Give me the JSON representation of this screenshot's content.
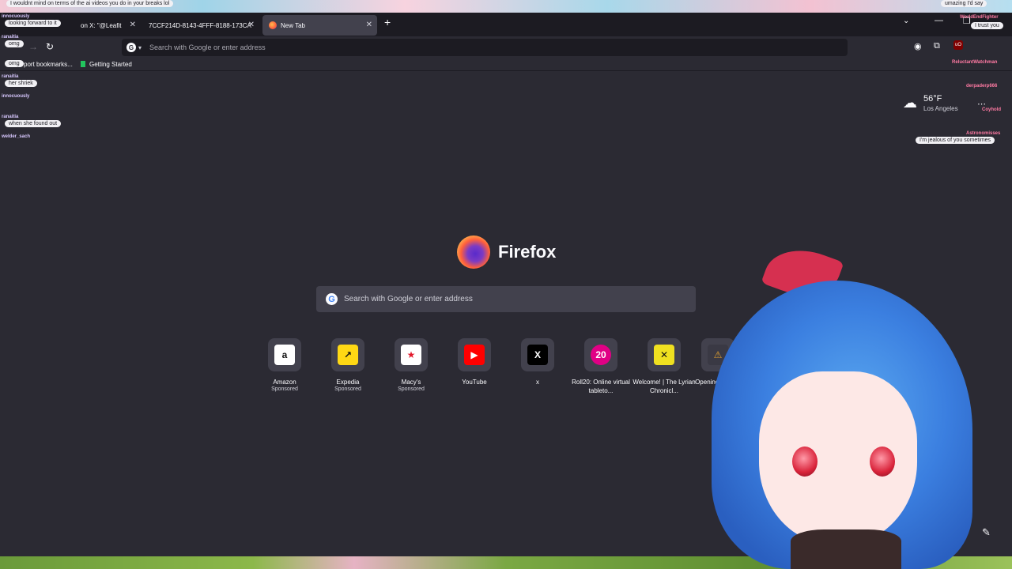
{
  "tabs": [
    {
      "label": "on X: \"@Leafit",
      "active": false
    },
    {
      "label": "7CCF214D-8143-4FFF-8188-173CA",
      "active": false
    },
    {
      "label": "New Tab",
      "active": true
    }
  ],
  "toolbar": {
    "url_placeholder": "Search with Google or enter address",
    "ublock_label": "uO"
  },
  "bookmarks": [
    {
      "label": "port bookmarks..."
    },
    {
      "label": "Getting Started"
    }
  ],
  "weather": {
    "temp": "56°F",
    "location": "Los Angeles"
  },
  "brand": {
    "wordmark": "Firefox"
  },
  "search": {
    "placeholder": "Search with Google or enter address"
  },
  "shortcuts": [
    {
      "title": "Amazon",
      "sub": "Sponsored",
      "icon_glyph": "a",
      "icon_bg": "#ffffff",
      "icon_fg": "#111111"
    },
    {
      "title": "Expedia",
      "sub": "Sponsored",
      "icon_glyph": "↗",
      "icon_bg": "#ffd814",
      "icon_fg": "#111111"
    },
    {
      "title": "Macy's",
      "sub": "Sponsored",
      "icon_glyph": "★",
      "icon_bg": "#ffffff",
      "icon_fg": "#e21a2c"
    },
    {
      "title": "YouTube",
      "sub": "",
      "icon_glyph": "▶",
      "icon_bg": "#ff0000",
      "icon_fg": "#ffffff"
    },
    {
      "title": "x",
      "sub": "",
      "icon_glyph": "X",
      "icon_bg": "#000000",
      "icon_fg": "#ffffff"
    },
    {
      "title": "Roll20: Online virtual tableto...",
      "sub": "",
      "icon_glyph": "20",
      "icon_bg": "#e10085",
      "icon_fg": "#ffffff"
    },
    {
      "title": "Welcome! | The Lyrian Chronicl...",
      "sub": "",
      "icon_glyph": "✕",
      "icon_bg": "#f0e020",
      "icon_fg": "#111111"
    },
    {
      "title": "Opening Pan de",
      "sub": "",
      "icon_glyph": "⚠",
      "icon_bg": "#3a3944",
      "icon_fg": "#e0a030"
    }
  ],
  "chat_left": [
    {
      "text": "I wouldnt mind on terms of the ai videos you do in your breaks lol"
    },
    {
      "name": "innocuously"
    },
    {
      "text": "looking forward to it"
    },
    {
      "name": "ranaitia"
    },
    {
      "text": "omg"
    },
    {
      "text": "omg"
    },
    {
      "name": "ranaitia"
    },
    {
      "text": "her shriek"
    },
    {
      "name": "innocuously"
    },
    {
      "name": "ranaitia"
    },
    {
      "text": "when she found out"
    },
    {
      "name": "welder_sach"
    }
  ],
  "chat_right": [
    {
      "text": "umazing I'd say"
    },
    {
      "name": "WorldEndFighter"
    },
    {
      "text": "I trust you"
    },
    {
      "name": "ReluctantWatchman"
    },
    {
      "name": "derpaderp666"
    },
    {
      "name": "Coyhold"
    },
    {
      "name": "Astronomisses"
    },
    {
      "text": "I'm jealous of you sometimes"
    }
  ]
}
